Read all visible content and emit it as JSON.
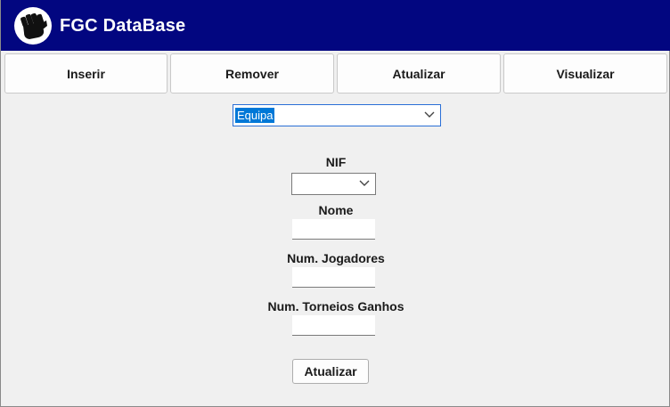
{
  "app": {
    "title": "FGC DataBase",
    "logo_icon": "fist-icon"
  },
  "nav": [
    {
      "label": "Inserir"
    },
    {
      "label": "Remover"
    },
    {
      "label": "Atualizar"
    },
    {
      "label": "Visualizar"
    }
  ],
  "entity_select": {
    "value": "Equipa"
  },
  "form": {
    "nif_label": "NIF",
    "nif_value": "",
    "nome_label": "Nome",
    "nome_value": "",
    "jogadores_label": "Num. Jogadores",
    "jogadores_value": "",
    "torneios_label": "Num. Torneios Ganhos",
    "torneios_value": "",
    "submit_label": "Atualizar"
  },
  "colors": {
    "titlebar": "#020680",
    "selection": "#0078d7"
  }
}
